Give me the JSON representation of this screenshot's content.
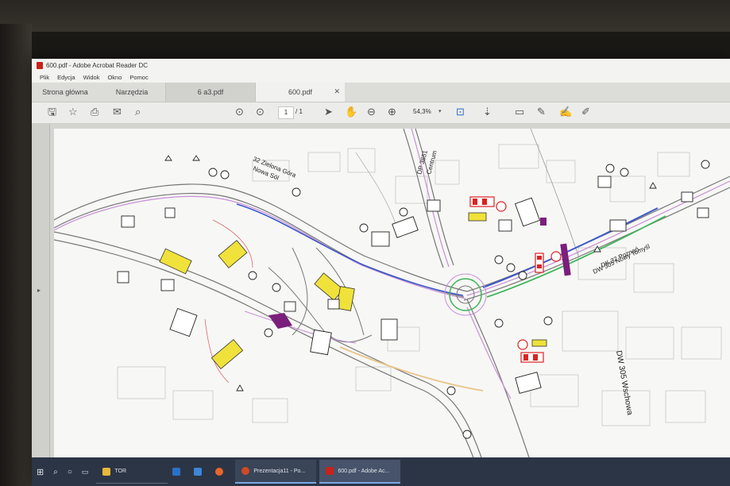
{
  "window": {
    "title": "600.pdf - Adobe Acrobat Reader DC"
  },
  "menu": [
    "Plik",
    "Edycja",
    "Widok",
    "Okno",
    "Pomoc"
  ],
  "tabs": {
    "home": "Strona główna",
    "tools": "Narzędzia",
    "doc1": "6 a3.pdf",
    "doc2": "600.pdf"
  },
  "toolbar": {
    "page_current": "1",
    "page_total": "/ 1",
    "zoom": "54,3%"
  },
  "map": {
    "road_label_1": "32 Zielona Góra",
    "road_label_2": "Nowa Sól",
    "road_label_3": "DP 3851",
    "road_label_4": "Centrum",
    "road_label_5": "DK 32 Poznań",
    "road_label_6": "DW 305 Nowy Tomyśl",
    "road_label_7": "DW 305 Wschowa"
  },
  "taskbar": {
    "item_tor": "TOR",
    "item_presentation": "Prezentacja11 - Po...",
    "item_pdf": "600.pdf - Adobe Ac..."
  },
  "colors": {
    "taskbar_bg": "#2c3545",
    "road_purple": "#c88fd6",
    "road_blue": "#3b57c9",
    "road_green": "#3fb55a",
    "sign_yellow": "#f0e23a"
  }
}
